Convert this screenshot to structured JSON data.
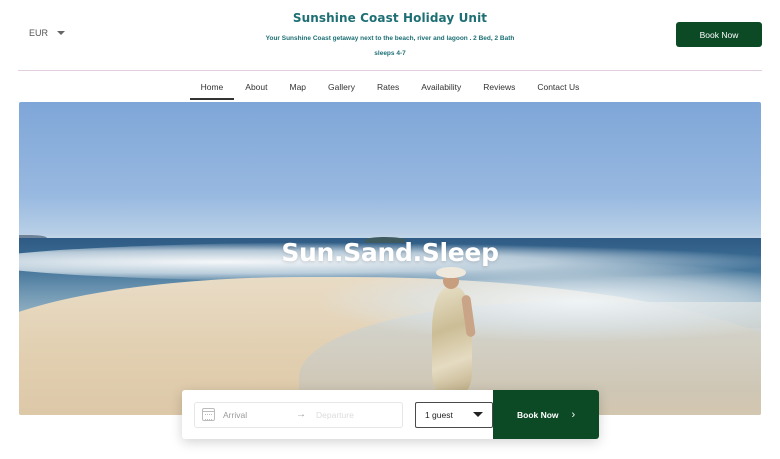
{
  "header": {
    "currency": "EUR",
    "title": "Sunshine Coast Holiday Unit",
    "tagline": "Your Sunshine Coast getaway next to the beach, river and lagoon . 2 Bed, 2 Bath sleeps 4-7",
    "book_label": "Book Now"
  },
  "nav": {
    "items": [
      {
        "label": "Home",
        "active": true
      },
      {
        "label": "About"
      },
      {
        "label": "Map"
      },
      {
        "label": "Gallery"
      },
      {
        "label": "Rates"
      },
      {
        "label": "Availability"
      },
      {
        "label": "Reviews"
      },
      {
        "label": "Contact Us"
      }
    ]
  },
  "hero": {
    "title": "Sun.Sand.Sleep"
  },
  "booking": {
    "arrival_placeholder": "Arrival",
    "departure_placeholder": "Departure",
    "guests_value": "1 guest",
    "book_label": "Book Now",
    "arrow_glyph": "→",
    "chevron_glyph": "›"
  },
  "colors": {
    "brand_teal": "#1d6f74",
    "button_green": "#0c4a26",
    "divider": "#e2cfe2"
  }
}
